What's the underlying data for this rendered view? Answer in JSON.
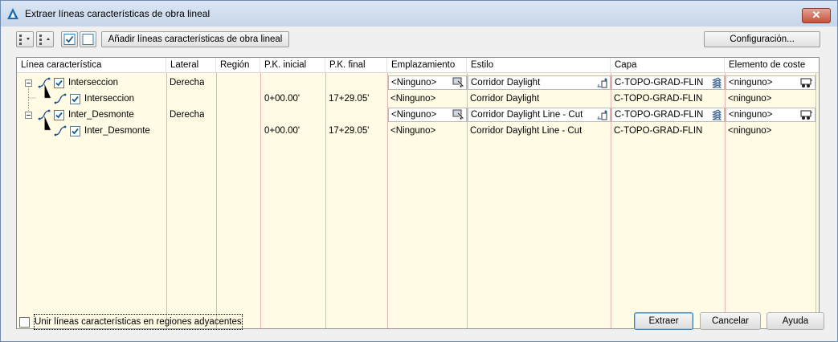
{
  "window": {
    "title": "Extraer líneas características de obra lineal",
    "close_label": "✕"
  },
  "toolbar": {
    "add_label": "Añadir líneas características de obra lineal",
    "config_label": "Configuración..."
  },
  "columns": [
    "Línea característica",
    "Lateral",
    "Región",
    "P.K. inicial",
    "P.K. final",
    "Emplazamiento",
    "Estilo",
    "Capa",
    "Elemento de coste"
  ],
  "rows": [
    {
      "name": "Interseccion",
      "lateral": "Derecha",
      "region": "",
      "pk_inicial": "",
      "pk_final": "",
      "emplazamiento": "<Ninguno>",
      "estilo": "Corridor Daylight",
      "capa": "C-TOPO-GRAD-FLIN",
      "coste": "<ninguno>",
      "checked": true
    },
    {
      "name": "Interseccion",
      "lateral": "",
      "region": "",
      "pk_inicial": "0+00.00'",
      "pk_final": "17+29.05'",
      "emplazamiento": "<Ninguno>",
      "estilo": "Corridor Daylight",
      "capa": "C-TOPO-GRAD-FLIN",
      "coste": "<ninguno>",
      "checked": true
    },
    {
      "name": "Inter_Desmonte",
      "lateral": "Derecha",
      "region": "",
      "pk_inicial": "",
      "pk_final": "",
      "emplazamiento": "<Ninguno>",
      "estilo": "Corridor Daylight Line - Cut",
      "capa": "C-TOPO-GRAD-FLIN",
      "coste": "<ninguno>",
      "checked": true
    },
    {
      "name": "Inter_Desmonte",
      "lateral": "",
      "region": "",
      "pk_inicial": "0+00.00'",
      "pk_final": "17+29.05'",
      "emplazamiento": "<Ninguno>",
      "estilo": "Corridor Daylight Line - Cut",
      "capa": "C-TOPO-GRAD-FLIN",
      "coste": "<ninguno>",
      "checked": true
    }
  ],
  "footer": {
    "merge_label": "Unir líneas características en regiones adyacentes",
    "merge_checked": false,
    "extract_label": "Extraer",
    "cancel_label": "Cancelar",
    "help_label": "Ayuda"
  },
  "icons": {
    "app": "autodesk-civil-icon",
    "tree_expand": "tree-minus-icon",
    "pick": "pick-from-drawing-icon",
    "style_edit": "style-edit-icon",
    "layer": "layer-icon",
    "pay_item": "pay-item-icon"
  },
  "colors": {
    "grid_bg": "#fffbe5",
    "column_separator": "#e6b4b4",
    "check": "#3c7fb1"
  }
}
